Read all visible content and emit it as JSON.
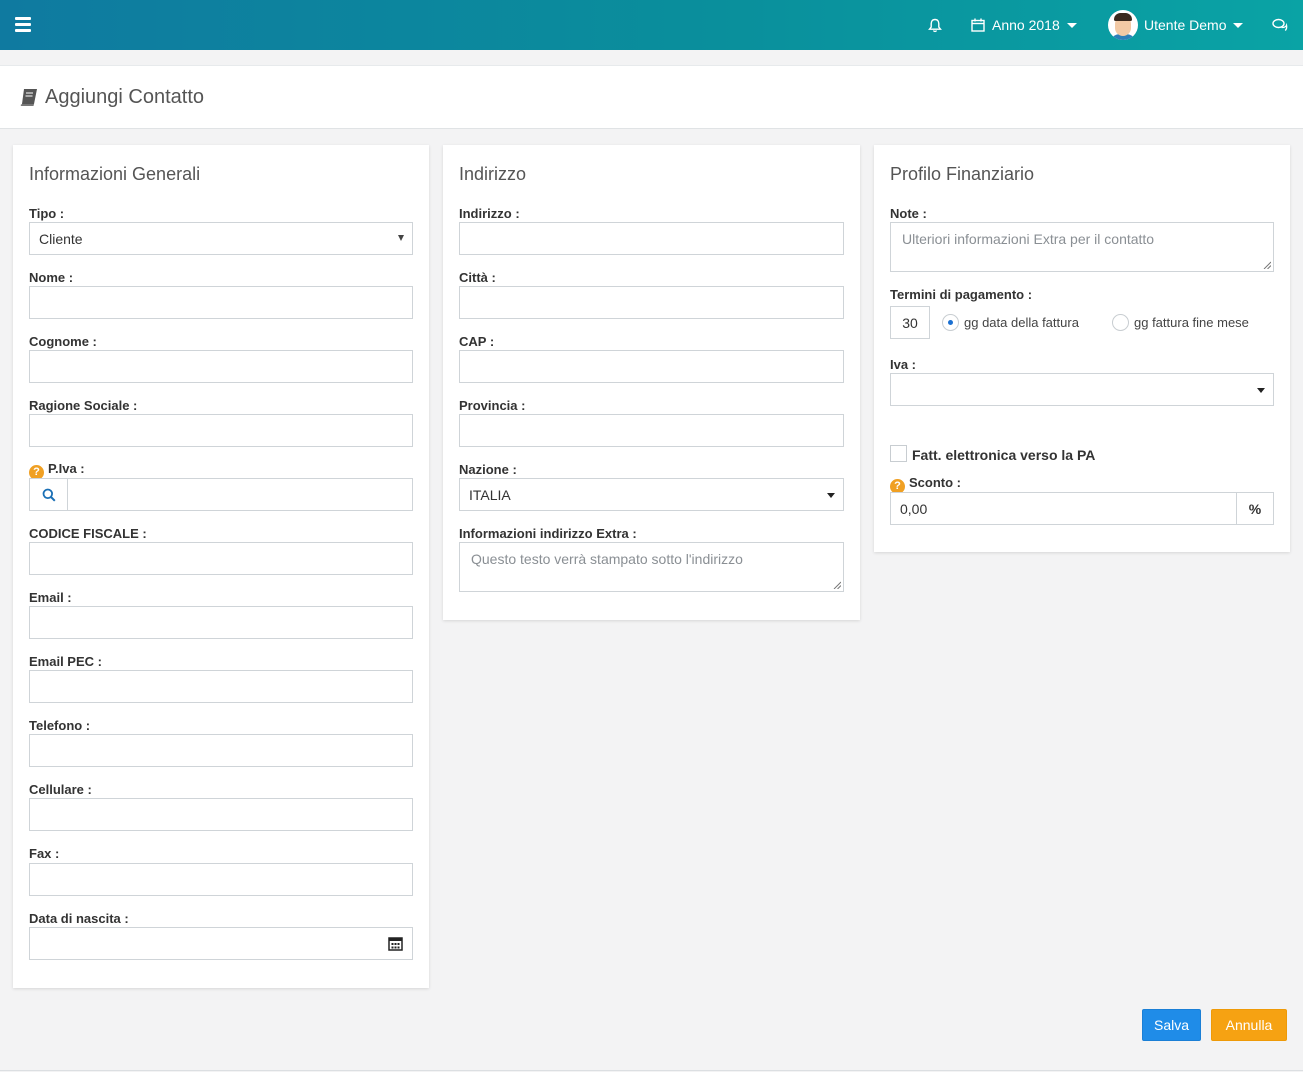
{
  "topbar": {
    "menu_icon": "hamburger-menu-icon",
    "bell_icon": "bell-icon",
    "year_icon": "calendar-icon",
    "year_label": "Anno 2018",
    "user_name": "Utente Demo",
    "chat_icon": "chat-icon",
    "colors": {
      "gradient_start": "#0f7aa0",
      "gradient_end": "#0aa3a5"
    }
  },
  "page": {
    "title": "Aggiungi Contatto",
    "title_icon": "book-icon"
  },
  "general": {
    "title": "Informazioni Generali",
    "tipo_label": "Tipo :",
    "tipo_value": "Cliente",
    "nome_label": "Nome :",
    "cognome_label": "Cognome :",
    "ragione_label": "Ragione Sociale :",
    "piva_label": "P.Iva :",
    "piva_help": "?",
    "codice_label": "CODICE FISCALE :",
    "email_label": "Email :",
    "pec_label": "Email PEC :",
    "telefono_label": "Telefono :",
    "cellulare_label": "Cellulare :",
    "fax_label": "Fax :",
    "nascita_label": "Data di nascita :"
  },
  "address": {
    "title": "Indirizzo",
    "indirizzo_label": "Indirizzo :",
    "citta_label": "Città :",
    "cap_label": "CAP :",
    "provincia_label": "Provincia :",
    "nazione_label": "Nazione :",
    "nazione_value": "ITALIA",
    "extra_label": "Informazioni indirizzo Extra :",
    "extra_placeholder": "Questo testo verrà stampato sotto l'indirizzo"
  },
  "finance": {
    "title": "Profilo Finanziario",
    "note_label": "Note :",
    "note_placeholder": "Ulteriori informazioni Extra per il contatto",
    "termini_label": "Termini di pagamento :",
    "termini_value": "30",
    "radio_1": "gg data della fattura",
    "radio_2": "gg fattura fine mese",
    "iva_label": "Iva :",
    "pa_label": "Fatt. elettronica verso la PA",
    "sconto_label": "Sconto :",
    "sconto_help": "?",
    "sconto_value": "0,00",
    "sconto_unit": "%"
  },
  "actions": {
    "save": "Salva",
    "cancel": "Annulla",
    "colors": {
      "save": "#1f8ce8",
      "cancel": "#f6a212"
    }
  }
}
